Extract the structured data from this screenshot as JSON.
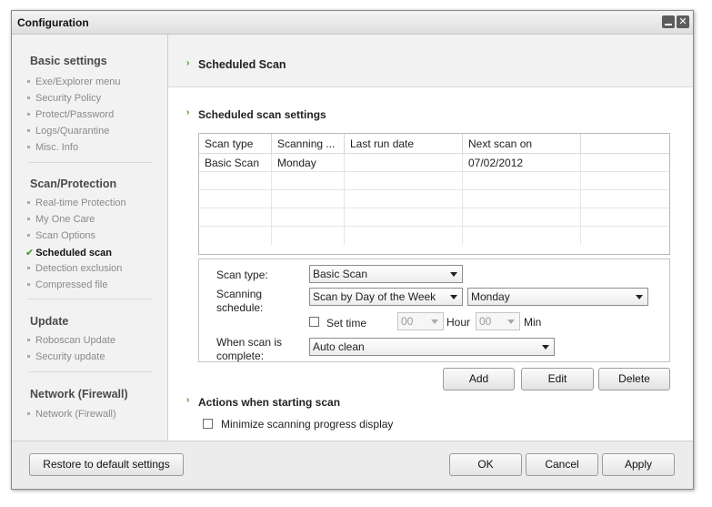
{
  "window": {
    "title": "Configuration"
  },
  "sidebar": {
    "groups": [
      {
        "heading": "Basic settings",
        "items": [
          "Exe/Explorer menu",
          "Security Policy",
          "Protect/Password",
          "Logs/Quarantine",
          "Misc. Info"
        ]
      },
      {
        "heading": "Scan/Protection",
        "items": [
          "Real-time Protection",
          "My One Care",
          "Scan Options",
          "Scheduled scan",
          "Detection exclusion",
          "Compressed file"
        ]
      },
      {
        "heading": "Update",
        "items": [
          "Roboscan Update",
          "Security update"
        ]
      },
      {
        "heading": "Network (Firewall)",
        "items": [
          "Network (Firewall)"
        ]
      }
    ],
    "active_item": "Scheduled scan"
  },
  "main": {
    "page_title": "Scheduled Scan",
    "settings_section": "Scheduled scan settings",
    "table": {
      "columns": [
        "Scan type",
        "Scanning ...",
        "Last run date",
        "Next scan on"
      ],
      "rows": [
        [
          "Basic Scan",
          "Monday",
          "",
          "07/02/2012"
        ]
      ]
    },
    "form": {
      "scan_type_label": "Scan type:",
      "scan_type_value": "Basic Scan",
      "schedule_label_1": "Scanning",
      "schedule_label_2": "schedule:",
      "schedule_value": "Scan by Day of the Week",
      "day_value": "Monday",
      "set_time_label": "Set time",
      "hour_value": "00",
      "hour_label": "Hour",
      "min_value": "00",
      "min_label": "Min",
      "complete_label_1": "When scan is",
      "complete_label_2": "complete:",
      "complete_value": "Auto clean"
    },
    "buttons": {
      "add": "Add",
      "edit": "Edit",
      "delete": "Delete"
    },
    "actions_section": "Actions when starting scan",
    "minimize_label": "Minimize scanning progress display"
  },
  "footer": {
    "restore": "Restore to default settings",
    "ok": "OK",
    "cancel": "Cancel",
    "apply": "Apply"
  },
  "colors": {
    "accent_green": "#3a9a1a"
  }
}
